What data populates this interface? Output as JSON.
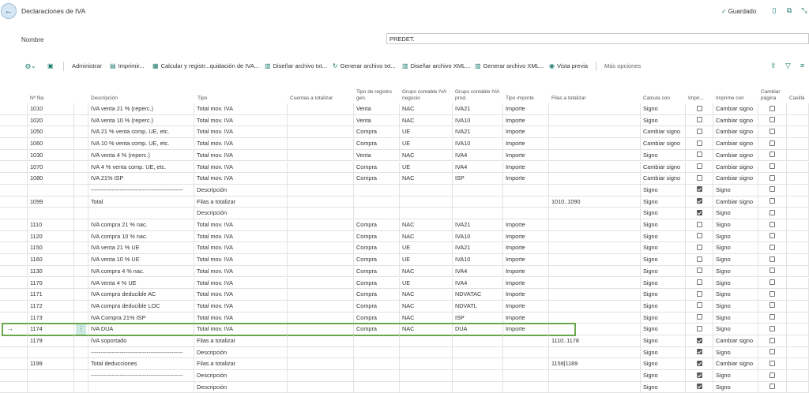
{
  "header": {
    "title": "Declaraciones de IVA",
    "saved_label": "Guardado",
    "saved_check": "✓"
  },
  "nombre": {
    "label": "Nombre",
    "value": "PREDET."
  },
  "actions": {
    "administrar": "Administrar",
    "imprimir": "Imprimir...",
    "calcular": "Calcular y registr...quidación de IVA...",
    "disenar_txt": "Diseñar archivo txt...",
    "generar_txt": "Generar archivo txt...",
    "disenar_xml": "Diseñar archivo XML...",
    "generar_xml": "Generar archivo XML...",
    "vista_previa": "Vista previa",
    "mas_opciones": "Más opciones"
  },
  "columns": {
    "nfila": "Nº fila",
    "descripcion": "Descripción",
    "tipo": "Tipo",
    "cuentas": "Cuentas a totalizar",
    "tipo_registro_1": "Tipo de registro",
    "tipo_registro_2": "gen.",
    "grupo_negocio_1": "Grupo contable IVA",
    "grupo_negocio_2": "negocio",
    "grupo_prod_1": "Grupo contable IVA",
    "grupo_prod_2": "prod.",
    "tipo_importe": "Tipo importe",
    "filas_totalizar": "Filas a totalizar",
    "calcula_con": "Calcula con",
    "imprimir": "Impri...",
    "imprime_con": "Imprime con",
    "cambiar_pagina_1": "Cambiar",
    "cambiar_pagina_2": "página",
    "casilla": "Casilla"
  },
  "rows": [
    {
      "nfila": "1010",
      "desc": "IVA venta 21 % (reperc.)",
      "tipo": "Total mov. IVA",
      "reg": "Venta",
      "neg": "NAC",
      "prod": "IVA21",
      "imp": "Importe",
      "filas": "",
      "calc": "Signo",
      "print": false,
      "impcon": "Cambiar signo",
      "page": false
    },
    {
      "nfila": "1020",
      "desc": "IVA venta 10 % (reperc.)",
      "tipo": "Total mov. IVA",
      "reg": "Venta",
      "neg": "NAC",
      "prod": "IVA10",
      "imp": "Importe",
      "filas": "",
      "calc": "Signo",
      "print": false,
      "impcon": "Cambiar signo",
      "page": false
    },
    {
      "nfila": "1050",
      "desc": "IVA 21 % venta comp. UE, etc.",
      "tipo": "Total mov. IVA",
      "reg": "Compra",
      "neg": "UE",
      "prod": "IVA21",
      "imp": "Importe",
      "filas": "",
      "calc": "Cambiar signo",
      "print": false,
      "impcon": "Cambiar signo",
      "page": false
    },
    {
      "nfila": "1060",
      "desc": "IVA 10 % venta comp. UE, etc.",
      "tipo": "Total mov. IVA",
      "reg": "Compra",
      "neg": "UE",
      "prod": "IVA10",
      "imp": "Importe",
      "filas": "",
      "calc": "Cambiar signo",
      "print": false,
      "impcon": "Cambiar signo",
      "page": false
    },
    {
      "nfila": "1030",
      "desc": "IVA venta 4 % (reperc.)",
      "tipo": "Total mov. IVA",
      "reg": "Venta",
      "neg": "NAC",
      "prod": "IVA4",
      "imp": "Importe",
      "filas": "",
      "calc": "Signo",
      "print": false,
      "impcon": "Cambiar signo",
      "page": false
    },
    {
      "nfila": "1070",
      "desc": "IVA 4 % venta comp. UE, etc.",
      "tipo": "Total mov. IVA",
      "reg": "Compra",
      "neg": "UE",
      "prod": "IVA4",
      "imp": "Importe",
      "filas": "",
      "calc": "Cambiar signo",
      "print": false,
      "impcon": "Cambiar signo",
      "page": false
    },
    {
      "nfila": "1080",
      "desc": "IVA 21% ISP",
      "tipo": "Total mov. IVA",
      "reg": "Compra",
      "neg": "NAC",
      "prod": "ISP",
      "imp": "Importe",
      "filas": "",
      "calc": "Cambiar signo",
      "print": false,
      "impcon": "Cambiar signo",
      "page": false
    },
    {
      "nfila": "",
      "desc": "------------------------------------------------",
      "tipo": "Descripción",
      "reg": "",
      "neg": "",
      "prod": "",
      "imp": "",
      "filas": "",
      "calc": "Signo",
      "print": true,
      "impcon": "Signo",
      "page": false
    },
    {
      "nfila": "1099",
      "desc": "Total",
      "tipo": "Filas a totalizar",
      "reg": "",
      "neg": "",
      "prod": "",
      "imp": "",
      "filas": "1010..1090",
      "calc": "Signo",
      "print": true,
      "impcon": "Cambiar signo",
      "page": false
    },
    {
      "nfila": "",
      "desc": "",
      "tipo": "Descripción",
      "reg": "",
      "neg": "",
      "prod": "",
      "imp": "",
      "filas": "",
      "calc": "Signo",
      "print": true,
      "impcon": "Signo",
      "page": false
    },
    {
      "nfila": "1110",
      "desc": "IVA compra 21 % nac.",
      "tipo": "Total mov. IVA",
      "reg": "Compra",
      "neg": "NAC",
      "prod": "IVA21",
      "imp": "Importe",
      "filas": "",
      "calc": "Signo",
      "print": false,
      "impcon": "Signo",
      "page": false
    },
    {
      "nfila": "1120",
      "desc": "IVA compra 10 % nac.",
      "tipo": "Total mov. IVA",
      "reg": "Compra",
      "neg": "NAC",
      "prod": "IVA10",
      "imp": "Importe",
      "filas": "",
      "calc": "Signo",
      "print": false,
      "impcon": "Signo",
      "page": false
    },
    {
      "nfila": "1150",
      "desc": "IVA venta 21 % UE",
      "tipo": "Total mov. IVA",
      "reg": "Compra",
      "neg": "UE",
      "prod": "IVA21",
      "imp": "Importe",
      "filas": "",
      "calc": "Signo",
      "print": false,
      "impcon": "Signo",
      "page": false
    },
    {
      "nfila": "1160",
      "desc": "IVA venta 10 % UE",
      "tipo": "Total mov. IVA",
      "reg": "Compra",
      "neg": "UE",
      "prod": "IVA10",
      "imp": "Importe",
      "filas": "",
      "calc": "Signo",
      "print": false,
      "impcon": "Signo",
      "page": false
    },
    {
      "nfila": "1130",
      "desc": "IVA compra 4 % nac.",
      "tipo": "Total mov. IVA",
      "reg": "Compra",
      "neg": "NAC",
      "prod": "IVA4",
      "imp": "Importe",
      "filas": "",
      "calc": "Signo",
      "print": false,
      "impcon": "Signo",
      "page": false
    },
    {
      "nfila": "1170",
      "desc": "IVA venta 4 % UE",
      "tipo": "Total mov. IVA",
      "reg": "Compra",
      "neg": "UE",
      "prod": "IVA4",
      "imp": "Importe",
      "filas": "",
      "calc": "Signo",
      "print": false,
      "impcon": "Signo",
      "page": false
    },
    {
      "nfila": "1171",
      "desc": "IVA compra deducible AC",
      "tipo": "Total mov. IVA",
      "reg": "Compra",
      "neg": "NAC",
      "prod": "NDVATAC",
      "imp": "Importe",
      "filas": "",
      "calc": "Signo",
      "print": false,
      "impcon": "Signo",
      "page": false
    },
    {
      "nfila": "1172",
      "desc": "IVA compra deducible LOC",
      "tipo": "Total mov. IVA",
      "reg": "Compra",
      "neg": "NAC",
      "prod": "NDVATL",
      "imp": "Importe",
      "filas": "",
      "calc": "Signo",
      "print": false,
      "impcon": "Signo",
      "page": false
    },
    {
      "nfila": "1173",
      "desc": "IVA Compra 21% ISP",
      "tipo": "Total mov. IVA",
      "reg": "Compra",
      "neg": "NAC",
      "prod": "ISP",
      "imp": "Importe",
      "filas": "",
      "calc": "Signo",
      "print": false,
      "impcon": "Signo",
      "page": false
    },
    {
      "nfila": "1174",
      "desc": "IVA DUA",
      "tipo": "Total mov. IVA",
      "reg": "Compra",
      "neg": "NAC",
      "prod": "DUA",
      "imp": "Importe",
      "filas": "",
      "calc": "Signo",
      "print": false,
      "impcon": "Signo",
      "page": false
    },
    {
      "nfila": "1179",
      "desc": "IVA soportado",
      "tipo": "Filas a totalizar",
      "reg": "",
      "neg": "",
      "prod": "",
      "imp": "",
      "filas": "1110..1178",
      "calc": "Signo",
      "print": true,
      "impcon": "Cambiar signo",
      "page": false
    },
    {
      "nfila": "",
      "desc": "------------------------------------------------",
      "tipo": "Descripción",
      "reg": "",
      "neg": "",
      "prod": "",
      "imp": "",
      "filas": "",
      "calc": "Signo",
      "print": true,
      "impcon": "Signo",
      "page": false
    },
    {
      "nfila": "1199",
      "desc": "Total deducciones",
      "tipo": "Filas a totalizar",
      "reg": "",
      "neg": "",
      "prod": "",
      "imp": "",
      "filas": "1159|1189",
      "calc": "Signo",
      "print": true,
      "impcon": "Cambiar signo",
      "page": false
    },
    {
      "nfila": "",
      "desc": "------------------------------------------------",
      "tipo": "Descripción",
      "reg": "",
      "neg": "",
      "prod": "",
      "imp": "",
      "filas": "",
      "calc": "Signo",
      "print": true,
      "impcon": "Signo",
      "page": false
    },
    {
      "nfila": "",
      "desc": "",
      "tipo": "Descripción",
      "reg": "",
      "neg": "",
      "prod": "",
      "imp": "",
      "filas": "",
      "calc": "Signo",
      "print": true,
      "impcon": "Signo",
      "page": false
    }
  ],
  "selected_row_index": 19,
  "colors": {
    "accent": "#1b7a6d",
    "selection_border": "#6aa84f"
  }
}
